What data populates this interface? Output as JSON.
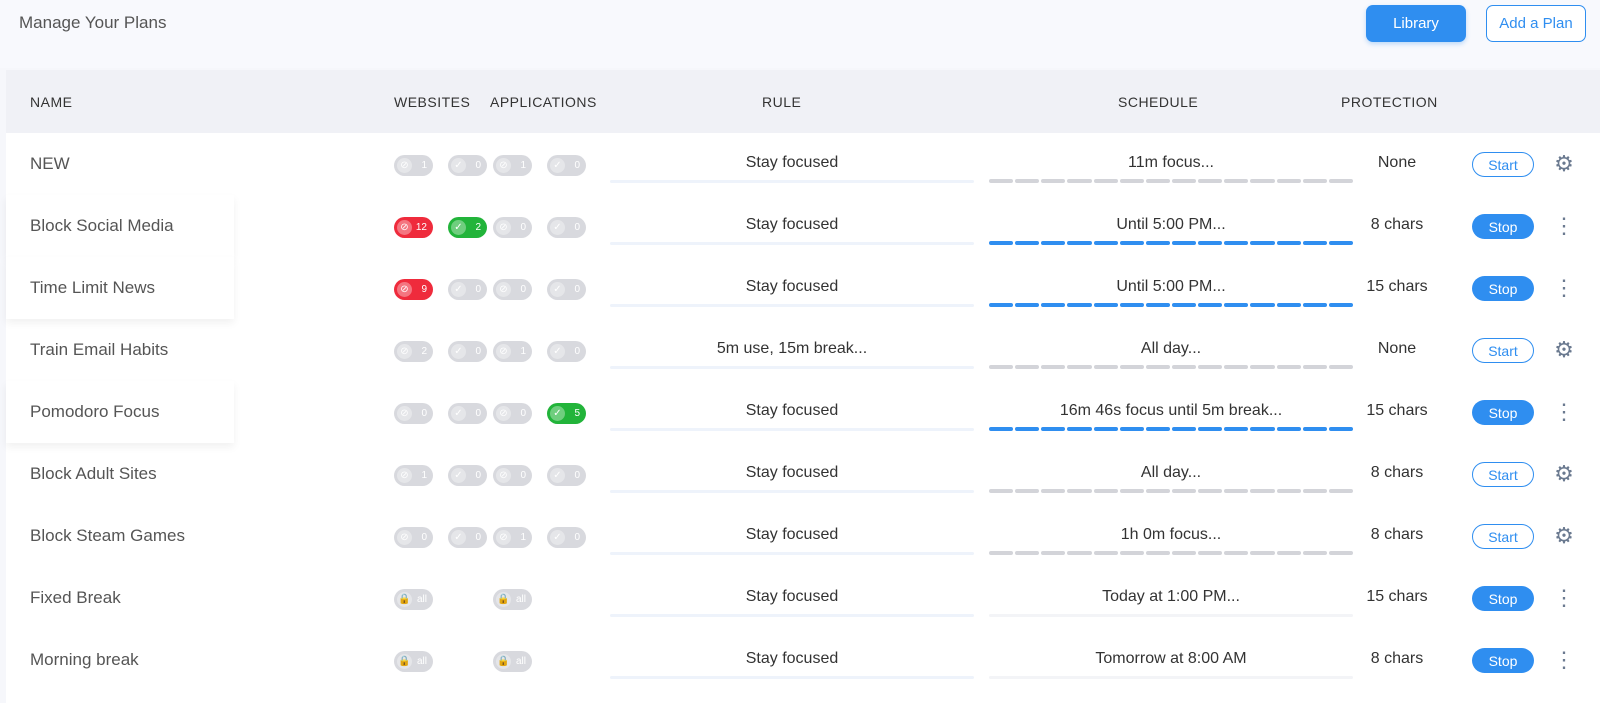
{
  "header": {
    "title": "Manage Your Plans",
    "library_label": "Library",
    "add_label": "Add a Plan"
  },
  "columns": {
    "name": "NAME",
    "websites": "WEBSITES",
    "applications": "APPLICATIONS",
    "rule": "RULE",
    "schedule": "SCHEDULE",
    "protection": "PROTECTION"
  },
  "colors": {
    "accent": "#2f8ef0",
    "block": "#ef2b3c",
    "allow": "#22b43a",
    "inactive": "#d8d9de"
  },
  "rows": [
    {
      "name": "NEW",
      "pills": [
        {
          "v": "1",
          "c": "grey",
          "i": "block"
        },
        {
          "v": "0",
          "c": "grey",
          "i": "check"
        },
        {
          "v": "1",
          "c": "grey",
          "i": "block"
        },
        {
          "v": "0",
          "c": "grey",
          "i": "check"
        }
      ],
      "rule": "Stay focused",
      "schedule": "11m focus...",
      "active": false,
      "protection": "None",
      "action": "Start",
      "menu": "gear"
    },
    {
      "name": "Block Social Media",
      "pills": [
        {
          "v": "12",
          "c": "red",
          "i": "block"
        },
        {
          "v": "2",
          "c": "green",
          "i": "check"
        },
        {
          "v": "0",
          "c": "grey",
          "i": "block"
        },
        {
          "v": "0",
          "c": "grey",
          "i": "check"
        }
      ],
      "rule": "Stay focused",
      "schedule": "Until 5:00 PM...",
      "active": true,
      "protection": "8 chars",
      "action": "Stop",
      "menu": "dots"
    },
    {
      "name": "Time Limit News",
      "pills": [
        {
          "v": "9",
          "c": "red",
          "i": "block"
        },
        {
          "v": "0",
          "c": "grey",
          "i": "check"
        },
        {
          "v": "0",
          "c": "grey",
          "i": "block"
        },
        {
          "v": "0",
          "c": "grey",
          "i": "check"
        }
      ],
      "rule": "Stay focused",
      "schedule": "Until 5:00 PM...",
      "active": true,
      "protection": "15 chars",
      "action": "Stop",
      "menu": "dots"
    },
    {
      "name": "Train Email Habits",
      "pills": [
        {
          "v": "2",
          "c": "grey",
          "i": "block"
        },
        {
          "v": "0",
          "c": "grey",
          "i": "check"
        },
        {
          "v": "1",
          "c": "grey",
          "i": "block"
        },
        {
          "v": "0",
          "c": "grey",
          "i": "check"
        }
      ],
      "rule": "5m use, 15m break...",
      "schedule": "All day...",
      "active": false,
      "protection": "None",
      "action": "Start",
      "menu": "gear"
    },
    {
      "name": "Pomodoro Focus",
      "pills": [
        {
          "v": "0",
          "c": "grey",
          "i": "block"
        },
        {
          "v": "0",
          "c": "grey",
          "i": "check"
        },
        {
          "v": "0",
          "c": "grey",
          "i": "block"
        },
        {
          "v": "5",
          "c": "green",
          "i": "check"
        }
      ],
      "rule": "Stay focused",
      "schedule": "16m 46s focus until 5m break...",
      "active": true,
      "protection": "15 chars",
      "action": "Stop",
      "menu": "dots"
    },
    {
      "name": "Block Adult Sites",
      "pills": [
        {
          "v": "1",
          "c": "grey",
          "i": "block"
        },
        {
          "v": "0",
          "c": "grey",
          "i": "check"
        },
        {
          "v": "0",
          "c": "grey",
          "i": "block"
        },
        {
          "v": "0",
          "c": "grey",
          "i": "check"
        }
      ],
      "rule": "Stay focused",
      "schedule": "All day...",
      "active": false,
      "protection": "8 chars",
      "action": "Start",
      "menu": "gear"
    },
    {
      "name": "Block Steam Games",
      "pills": [
        {
          "v": "0",
          "c": "grey",
          "i": "block"
        },
        {
          "v": "0",
          "c": "grey",
          "i": "check"
        },
        {
          "v": "1",
          "c": "grey",
          "i": "block"
        },
        {
          "v": "0",
          "c": "grey",
          "i": "check"
        }
      ],
      "rule": "Stay focused",
      "schedule": "1h 0m focus...",
      "active": false,
      "protection": "8 chars",
      "action": "Start",
      "menu": "gear"
    },
    {
      "name": "Fixed Break",
      "pills": [
        {
          "v": "all",
          "c": "grey",
          "i": "lock"
        },
        {
          "v": "all",
          "c": "grey",
          "i": "lock"
        }
      ],
      "rule": "Stay focused",
      "schedule": "Today at 1:00 PM...",
      "active": false,
      "protection": "15 chars",
      "action": "Stop",
      "menu": "dots"
    },
    {
      "name": "Morning break",
      "pills": [
        {
          "v": "all",
          "c": "grey",
          "i": "lock"
        },
        {
          "v": "all",
          "c": "grey",
          "i": "lock"
        }
      ],
      "rule": "Stay focused",
      "schedule": "Tomorrow at 8:00 AM",
      "active": false,
      "protection": "8 chars",
      "action": "Stop",
      "menu": "dots"
    }
  ]
}
